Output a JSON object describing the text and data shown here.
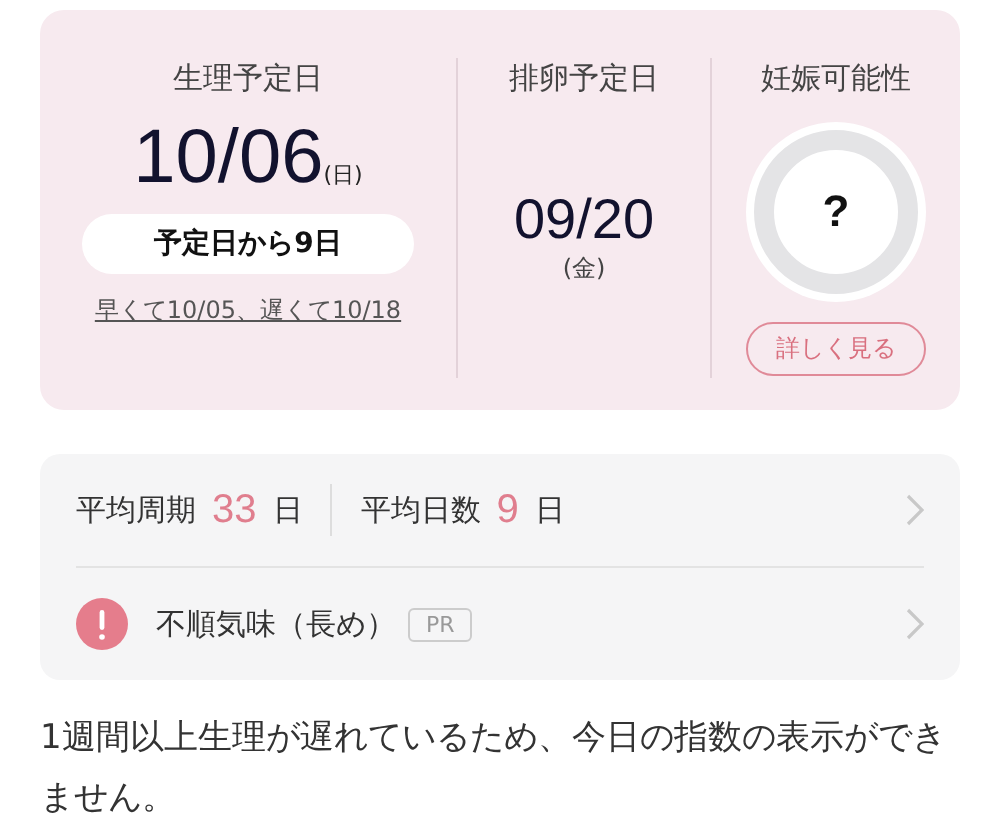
{
  "period": {
    "label": "生理予定日",
    "date": "10/06",
    "weekday": "(日)",
    "badge": "予定日から9日",
    "range_link": "早くて10/05、遅くて10/18"
  },
  "ovulation": {
    "label": "排卵予定日",
    "date": "09/20",
    "weekday": "(金)"
  },
  "fertility": {
    "label": "妊娠可能性",
    "value": "?",
    "button": "詳しく見る"
  },
  "stats": {
    "cycle_label": "平均周期",
    "cycle_value": "33",
    "cycle_unit": "日",
    "days_label": "平均日数",
    "days_value": "9",
    "days_unit": "日"
  },
  "alert": {
    "text": "不順気味（長め）",
    "tag": "PR"
  },
  "message": "1週間以上生理が遅れているため、今日の指数の表示ができません。"
}
